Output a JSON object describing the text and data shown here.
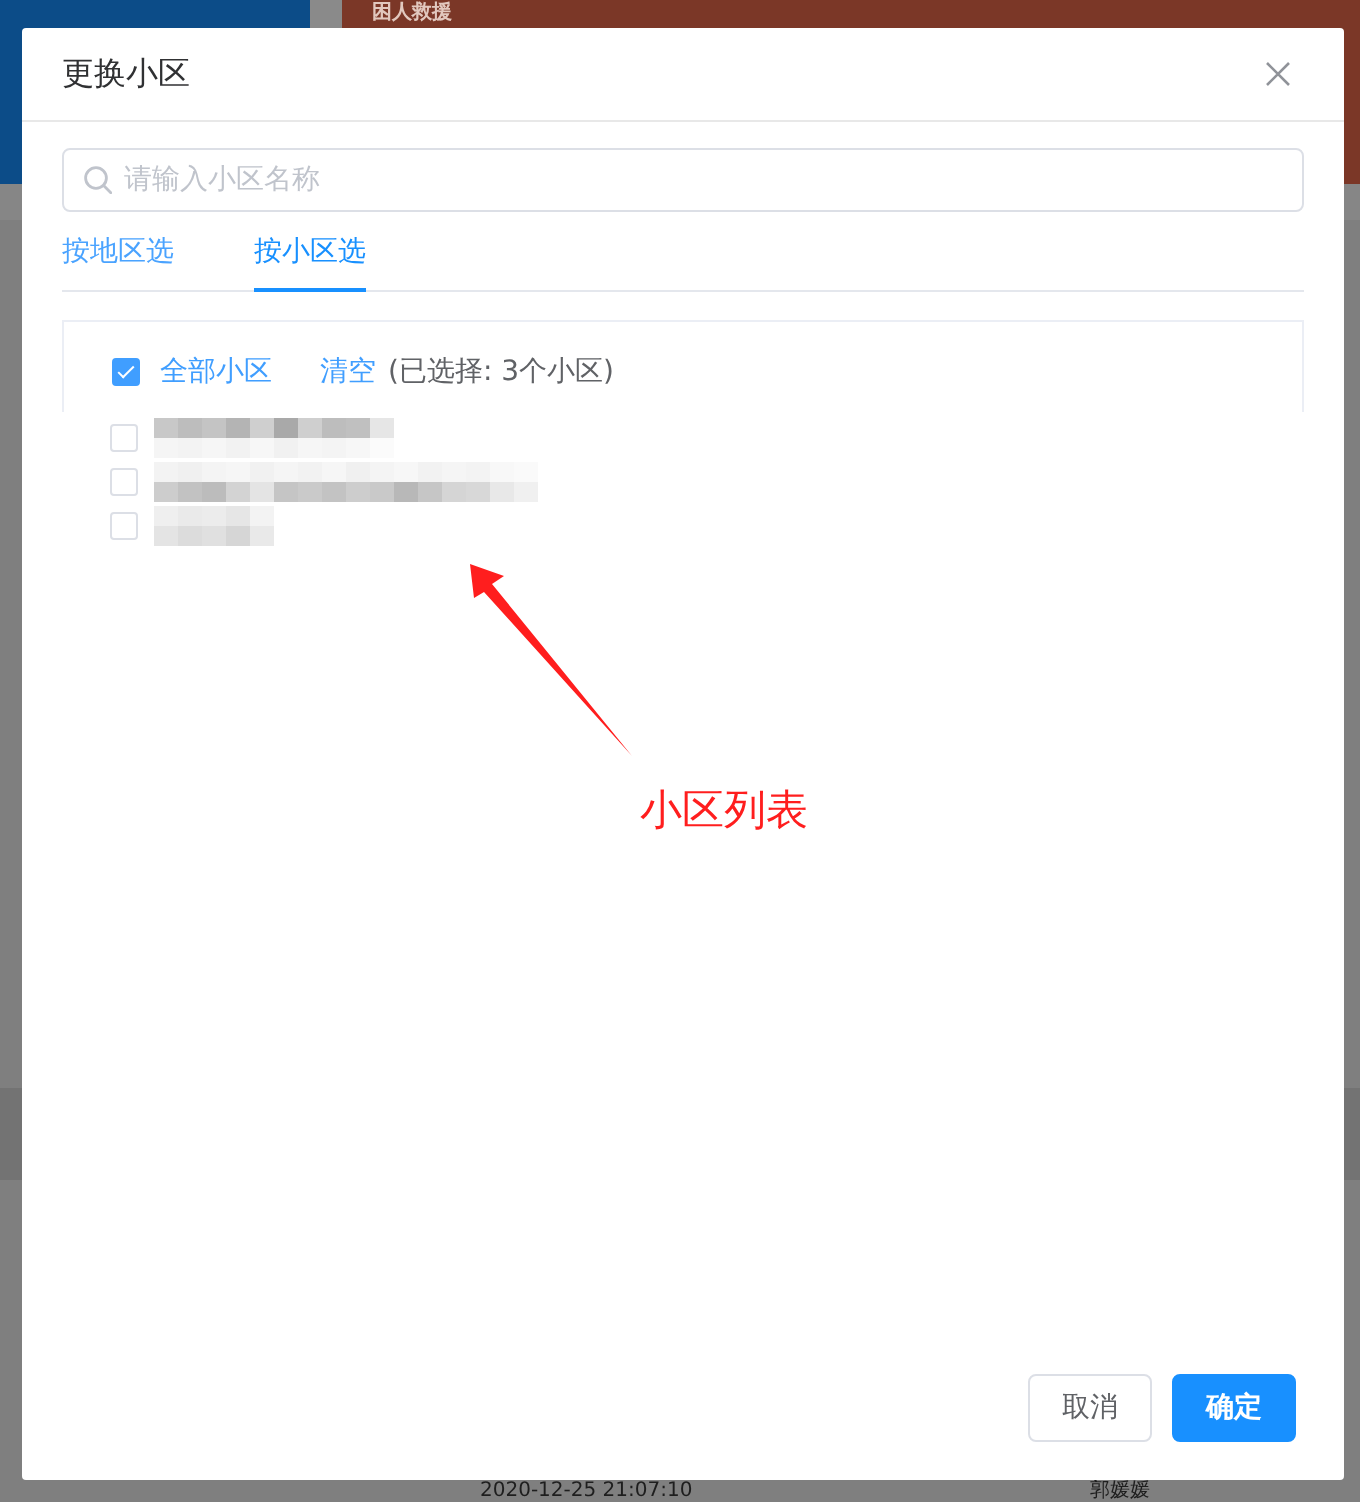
{
  "background": {
    "banner_title": "困人救援",
    "table_row": [
      "2020-12-25 21:07:10",
      "郭媛媛"
    ]
  },
  "dialog": {
    "title": "更换小区",
    "search": {
      "placeholder": "请输入小区名称"
    },
    "tabs": [
      {
        "label": "按地区选",
        "selected": false
      },
      {
        "label": "按小区选",
        "selected": true
      }
    ],
    "select_all": {
      "label": "全部小区",
      "checked": true
    },
    "clear_link": "清空",
    "selection_summary": "(已选择: 3个小区)",
    "options": [
      {
        "checked": false
      },
      {
        "checked": false
      },
      {
        "checked": false
      }
    ],
    "buttons": [
      {
        "label": "取消",
        "kind": "secondary"
      },
      {
        "label": "确定",
        "kind": "primary"
      }
    ]
  },
  "annotation": {
    "label": "小区列表"
  }
}
